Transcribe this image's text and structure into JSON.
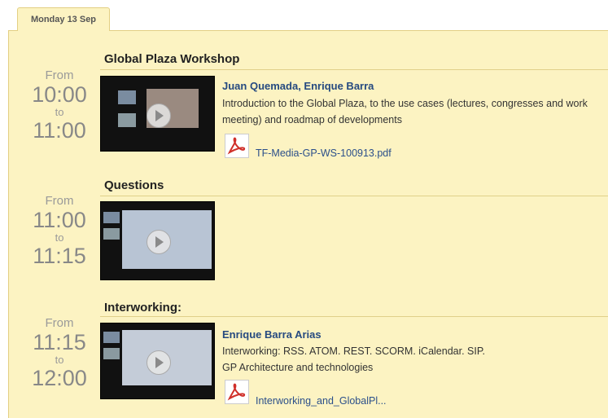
{
  "day_tab": "Monday 13 Sep",
  "sessions": [
    {
      "from_label": "From",
      "start": "10:00",
      "to_label": "to",
      "end": "11:00",
      "title": "Global Plaza Workshop",
      "speakers": "Juan Quemada, Enrique Barra",
      "description": "Introduction to the Global Plaza, to the use cases (lectures, congresses and work meeting) and roadmap of developments",
      "file": "TF-Media-GP-WS-100913.pdf"
    },
    {
      "from_label": "From",
      "start": "11:00",
      "to_label": "to",
      "end": "11:15",
      "title": "Questions"
    },
    {
      "from_label": "From",
      "start": "11:15",
      "to_label": "to",
      "end": "12:00",
      "title": "Interworking:",
      "speakers": "Enrique Barra Arias",
      "description_line1": "Interworking: RSS. ATOM. REST. SCORM. iCalendar. SIP.",
      "description_line2": "GP Architecture and technologies",
      "file": "Interworking_and_GlobalPl..."
    }
  ],
  "icons": {
    "play": "play-button-icon",
    "pdf": "pdf-file-icon"
  },
  "colors": {
    "panel": "#fcf3c2",
    "border": "#e3cf83",
    "link": "#264a80"
  }
}
